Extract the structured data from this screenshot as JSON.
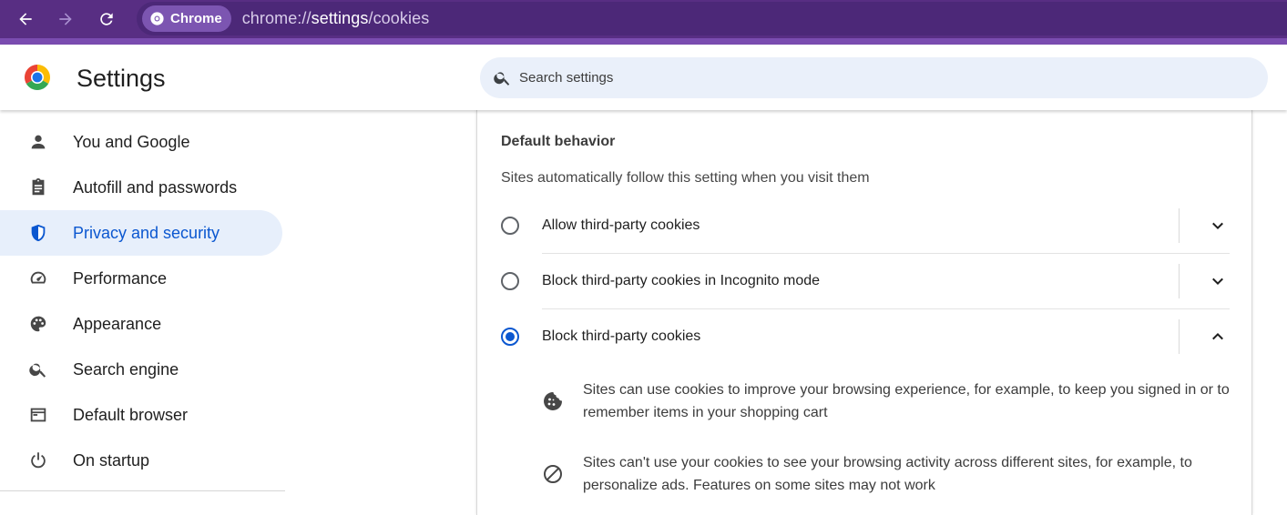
{
  "browser": {
    "chip_label": "Chrome",
    "url_scheme": "chrome://",
    "url_host": "settings",
    "url_path": "/cookies",
    "toolbar_color": "#582e83"
  },
  "header": {
    "title": "Settings",
    "search_placeholder": "Search settings"
  },
  "sidebar": {
    "items": [
      {
        "label": "You and Google",
        "icon": "person-icon",
        "active": false
      },
      {
        "label": "Autofill and passwords",
        "icon": "clipboard-icon",
        "active": false
      },
      {
        "label": "Privacy and security",
        "icon": "shield-icon",
        "active": true
      },
      {
        "label": "Performance",
        "icon": "speedometer-icon",
        "active": false
      },
      {
        "label": "Appearance",
        "icon": "palette-icon",
        "active": false
      },
      {
        "label": "Search engine",
        "icon": "search-icon",
        "active": false
      },
      {
        "label": "Default browser",
        "icon": "browser-window-icon",
        "active": false
      },
      {
        "label": "On startup",
        "icon": "power-icon",
        "active": false
      }
    ],
    "accent_color": "#0b57d0"
  },
  "content": {
    "section_title": "Default behavior",
    "section_description": "Sites automatically follow this setting when you visit them",
    "options": [
      {
        "label": "Allow third-party cookies",
        "selected": false,
        "expanded": false
      },
      {
        "label": "Block third-party cookies in Incognito mode",
        "selected": false,
        "expanded": false
      },
      {
        "label": "Block third-party cookies",
        "selected": true,
        "expanded": true
      }
    ],
    "details": [
      {
        "icon": "cookie-icon",
        "text": "Sites can use cookies to improve your browsing experience, for example, to keep you signed in or to remember items in your shopping cart"
      },
      {
        "icon": "block-icon",
        "text": "Sites can't use your cookies to see your browsing activity across different sites, for example, to personalize ads. Features on some sites may not work"
      }
    ]
  }
}
